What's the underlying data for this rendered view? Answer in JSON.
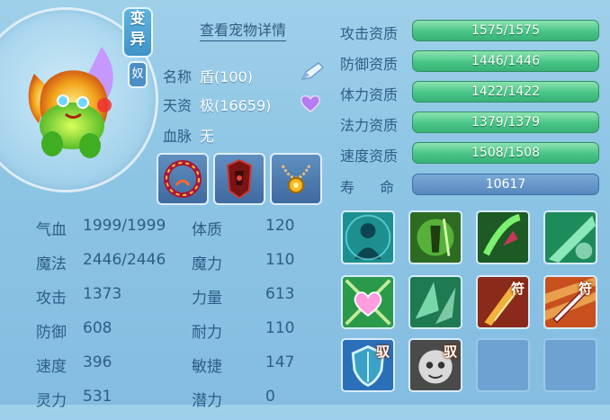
{
  "pet": {
    "mutate_badge": "变\n异",
    "mutate_badge_top": "变",
    "mutate_badge_bottom": "异",
    "partial_badge": "奴",
    "detail_link": "查看宠物详情",
    "name_label": "名称",
    "name_value": "盾(100)",
    "aptitude_label": "天资",
    "aptitude_value": "极(16659)",
    "bloodline_label": "血脉",
    "bloodline_value": "无"
  },
  "icons": {
    "rename": "pencil-icon",
    "favorite": "heart-icon"
  },
  "equipment": [
    {
      "name": "equip-collar"
    },
    {
      "name": "equip-armor"
    },
    {
      "name": "equip-necklace"
    }
  ],
  "stats": [
    {
      "label": "气血",
      "value": "1999/1999",
      "label2": "体质",
      "value2": "120"
    },
    {
      "label": "魔法",
      "value": "2446/2446",
      "label2": "魔力",
      "value2": "110"
    },
    {
      "label": "攻击",
      "value": "1373",
      "label2": "力量",
      "value2": "613"
    },
    {
      "label": "防御",
      "value": "608",
      "label2": "耐力",
      "value2": "110"
    },
    {
      "label": "速度",
      "value": "396",
      "label2": "敏捷",
      "value2": "147"
    },
    {
      "label": "灵力",
      "value": "531",
      "label2": "潜力",
      "value2": "0"
    }
  ],
  "qualities": [
    {
      "label": "攻击资质",
      "value": "1575/1575",
      "fill": 1.0
    },
    {
      "label": "防御资质",
      "value": "1446/1446",
      "fill": 1.0
    },
    {
      "label": "体力资质",
      "value": "1422/1422",
      "fill": 1.0
    },
    {
      "label": "法力资质",
      "value": "1379/1379",
      "fill": 1.0
    },
    {
      "label": "速度资质",
      "value": "1508/1508",
      "fill": 1.0
    }
  ],
  "lifespan": {
    "label_a": "寿",
    "label_b": "命",
    "value": "10617"
  },
  "skills": [
    {
      "name": "skill-silhouette-icon",
      "tag": ""
    },
    {
      "name": "skill-warrior-icon",
      "tag": ""
    },
    {
      "name": "skill-claw-icon",
      "tag": ""
    },
    {
      "name": "skill-light-beam-icon",
      "tag": ""
    },
    {
      "name": "skill-heart-burst-icon",
      "tag": ""
    },
    {
      "name": "skill-green-shards-icon",
      "tag": ""
    },
    {
      "name": "skill-red-strike-icon",
      "tag": "符"
    },
    {
      "name": "skill-sword-icon",
      "tag": "符"
    },
    {
      "name": "skill-shield-icon",
      "tag": "驭"
    },
    {
      "name": "skill-mask-icon",
      "tag": "驭"
    },
    {
      "name": "skill-slot-empty",
      "tag": ""
    },
    {
      "name": "skill-slot-empty",
      "tag": ""
    }
  ]
}
